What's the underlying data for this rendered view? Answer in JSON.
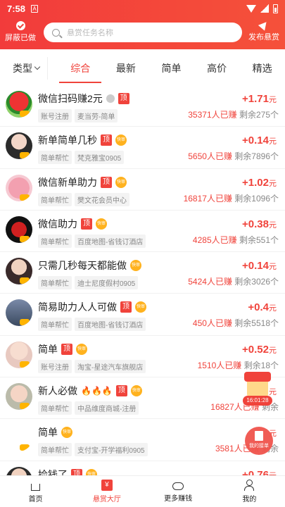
{
  "status_bar": {
    "time": "7:58",
    "notification_icon": "A"
  },
  "header": {
    "hide_done_label": "屏蔽已做",
    "search_placeholder": "悬赏任务名称",
    "publish_label": "发布悬赏"
  },
  "filter": {
    "type_label": "类型",
    "tabs": [
      "综合",
      "最新",
      "简单",
      "高价",
      "精选"
    ],
    "active_tab": "综合"
  },
  "tasks": [
    {
      "title": "微信扫码赚2元",
      "badge": "顶",
      "tags": [
        "账号注册",
        "麦当劳-简单"
      ],
      "reward": "+1.71",
      "unit": "元",
      "done_count": "35371人已赚",
      "remaining": "剩余275个"
    },
    {
      "title": "新单简单几秒",
      "badge": "顶",
      "fast": "快审",
      "tags": [
        "简单帮忙",
        "梵克雅宝0905"
      ],
      "reward": "+0.14",
      "unit": "元",
      "done_count": "5650人已赚",
      "remaining": "剩余7896个"
    },
    {
      "title": "微信新单助力",
      "badge": "顶",
      "fast": "快审",
      "tags": [
        "简单帮忙",
        "樊文花会员中心"
      ],
      "reward": "+1.02",
      "unit": "元",
      "done_count": "16817人已赚",
      "remaining": "剩余1096个"
    },
    {
      "title": "微信助力",
      "badge": "顶",
      "fast": "快审",
      "tags": [
        "简单帮忙",
        "百度地图-省钱订酒店"
      ],
      "reward": "+0.38",
      "unit": "元",
      "done_count": "4285人已赚",
      "remaining": "剩余551个"
    },
    {
      "title": "只需几秒每天都能做",
      "fast": "快审",
      "tags": [
        "简单帮忙",
        "迪士尼度假村0905"
      ],
      "reward": "+0.14",
      "unit": "元",
      "done_count": "5424人已赚",
      "remaining": "剩余3026个"
    },
    {
      "title": "简易助力人人可做",
      "badge": "顶",
      "fast": "快审",
      "tags": [
        "简单帮忙",
        "百度地图-省钱订酒店"
      ],
      "reward": "+0.4",
      "unit": "元",
      "done_count": "450人已赚",
      "remaining": "剩余5518个"
    },
    {
      "title": "简单",
      "badge": "顶",
      "fast": "快审",
      "tags": [
        "账号注册",
        "淘宝-星途汽车旗舰店"
      ],
      "reward": "+0.52",
      "unit": "元",
      "done_count": "1510人已赚",
      "remaining": "剩余18个"
    },
    {
      "title": "新人必做",
      "badge": "顶",
      "fast": "快审",
      "tags": [
        "简单帮忙",
        "中品维度商城-注册"
      ],
      "reward": "",
      "unit": "元",
      "done_count": "16827人已赚",
      "remaining": "剩余"
    },
    {
      "title": "简单",
      "fast": "快审",
      "tags": [
        "简单帮忙",
        "支付宝-开学福利0905"
      ],
      "reward": "",
      "unit": "元",
      "done_count": "3581人已赚",
      "remaining": "剩余"
    },
    {
      "title": "捡钱了",
      "badge": "顶",
      "fast": "快审",
      "tags": [],
      "reward": "+0.76",
      "unit": "元",
      "done_count": "",
      "remaining": ""
    }
  ],
  "floating": {
    "timer": "16:01:28",
    "my_order_label": "我的接单"
  },
  "bottom_nav": [
    "首页",
    "悬赏大厅",
    "更多赚钱",
    "我的"
  ],
  "colors": {
    "accent": "#f0433b",
    "header": "#f2473a"
  }
}
